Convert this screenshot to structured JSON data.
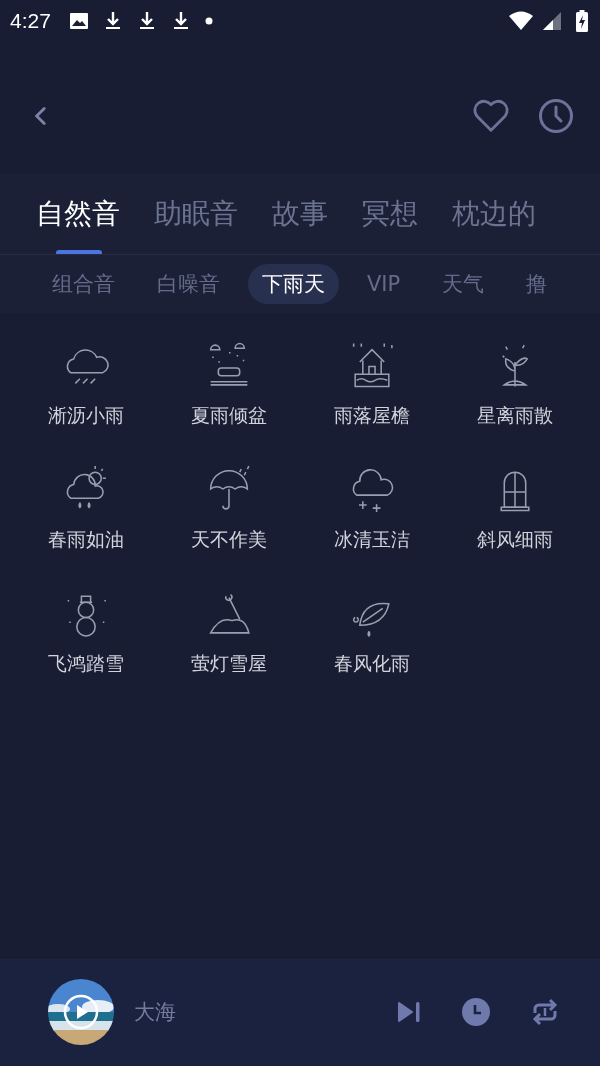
{
  "status_bar": {
    "time": "4:27"
  },
  "tabs": [
    {
      "label": "自然音",
      "selected": true
    },
    {
      "label": "助眠音",
      "selected": false
    },
    {
      "label": "故事",
      "selected": false
    },
    {
      "label": "冥想",
      "selected": false
    },
    {
      "label": "枕边的",
      "selected": false
    }
  ],
  "subtabs": [
    {
      "label": "组合音",
      "selected": false
    },
    {
      "label": "白噪音",
      "selected": false
    },
    {
      "label": "下雨天",
      "selected": true
    },
    {
      "label": "VIP",
      "selected": false
    },
    {
      "label": "天气",
      "selected": false
    },
    {
      "label": "撸",
      "selected": false
    }
  ],
  "sounds": [
    {
      "label": "淅沥小雨"
    },
    {
      "label": "夏雨倾盆"
    },
    {
      "label": "雨落屋檐"
    },
    {
      "label": "星离雨散"
    },
    {
      "label": "春雨如油"
    },
    {
      "label": "天不作美"
    },
    {
      "label": "冰清玉洁"
    },
    {
      "label": "斜风细雨"
    },
    {
      "label": "飞鸿踏雪"
    },
    {
      "label": "萤灯雪屋"
    },
    {
      "label": "春风化雨"
    }
  ],
  "player": {
    "title": "大海"
  }
}
